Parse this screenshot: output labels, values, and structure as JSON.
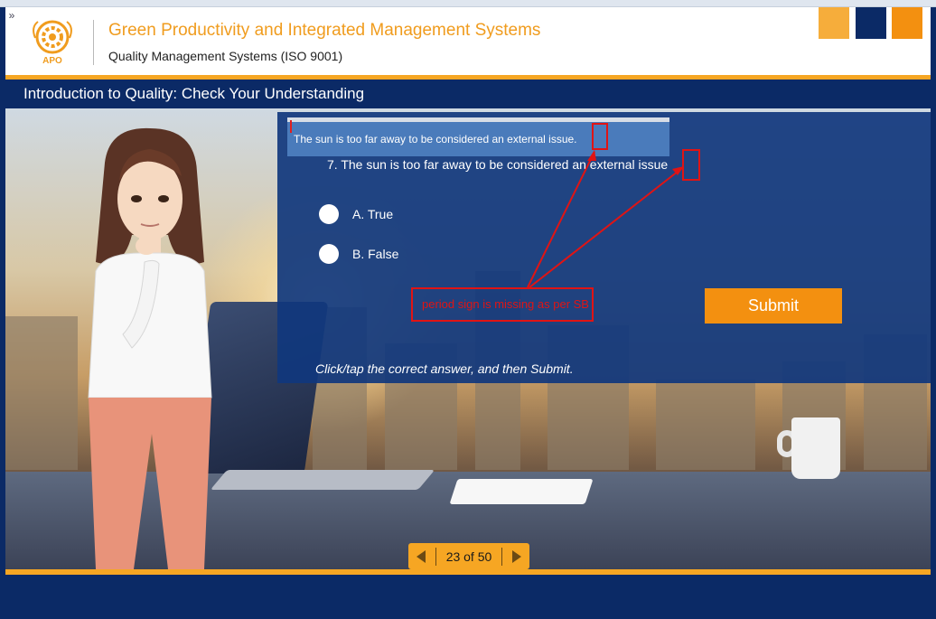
{
  "header": {
    "title": "Green Productivity and Integrated Management Systems",
    "subtitle": "Quality Management Systems (ISO 9001)",
    "logo_text": "APO",
    "expand_label": "»"
  },
  "slide": {
    "title": "Introduction to Quality: Check Your Understanding"
  },
  "quiz": {
    "question": "7. The sun is too far away to be considered an external issue",
    "options": [
      {
        "label": "A. True"
      },
      {
        "label": "B. False"
      }
    ],
    "submit_label": "Submit",
    "instruction": "Click/tap the correct answer, and then Submit."
  },
  "review": {
    "callout_text": "The sun is too far away to be considered  an external issue.",
    "comment": "period sign is missing as per SB"
  },
  "pager": {
    "text": "23 of 50"
  },
  "colors": {
    "navy": "#0b2a66",
    "orange": "#f39010",
    "light_orange": "#f6ad3b",
    "review_red": "#e01414"
  }
}
